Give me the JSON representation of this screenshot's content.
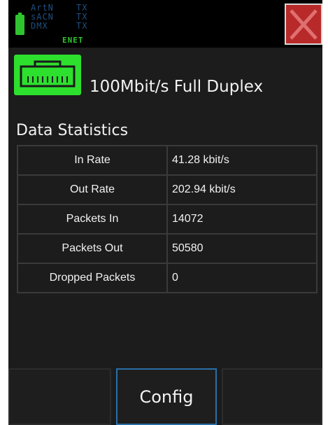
{
  "status_bar": {
    "protocols": [
      {
        "name": "ArtN",
        "state": "TX"
      },
      {
        "name": "sACN",
        "state": "TX"
      },
      {
        "name": "DMX",
        "state": "TX"
      }
    ],
    "interface": "ENET",
    "colors": {
      "battery": "#2fc42f",
      "interface": "#2fc42f",
      "protocol": "#1f4f7f",
      "close": "#b82a2a"
    }
  },
  "link": {
    "status": "100Mbit/s Full Duplex",
    "icon": "ethernet-port-icon",
    "icon_color": "#2ee02e"
  },
  "statistics": {
    "title": "Data Statistics",
    "rows": [
      {
        "label": "In Rate",
        "value": "41.28 kbit/s"
      },
      {
        "label": "Out Rate",
        "value": "202.94 kbit/s"
      },
      {
        "label": "Packets In",
        "value": "14072"
      },
      {
        "label": "Packets Out",
        "value": "50580"
      },
      {
        "label": "Dropped Packets",
        "value": "0"
      }
    ]
  },
  "bottom_bar": {
    "left_label": "",
    "config_label": "Config",
    "right_label": "",
    "accent": "#2a6fa8"
  }
}
